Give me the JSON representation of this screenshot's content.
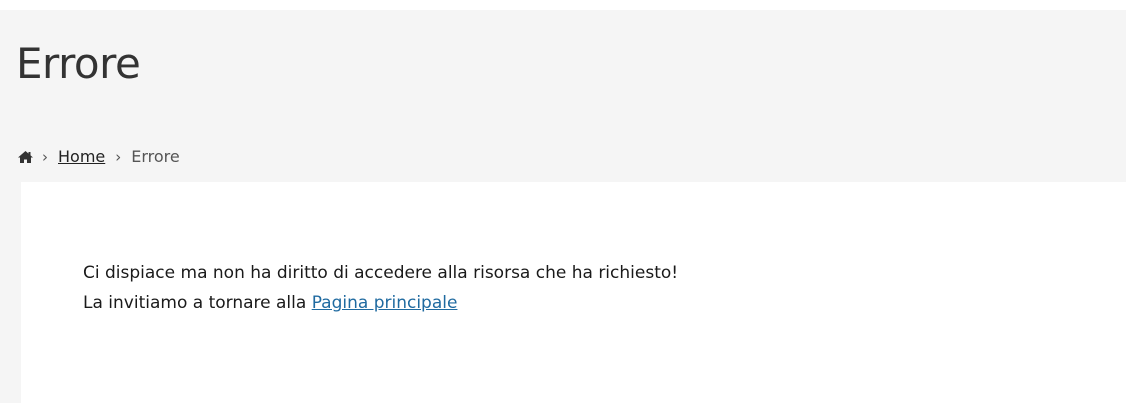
{
  "page": {
    "title": "Errore"
  },
  "breadcrumb": {
    "home_icon": "home-icon",
    "separator": "›",
    "items": [
      {
        "label": "Home",
        "type": "link"
      },
      {
        "label": "Errore",
        "type": "current"
      }
    ]
  },
  "content": {
    "line1": "Ci dispiace ma non ha diritto di accedere alla risorsa che ha richiesto!",
    "line2_prefix": "La invitiamo a tornare alla",
    "link_label": "Pagina principale"
  },
  "colors": {
    "header_background": "#f5f5f5",
    "link": "#1f6aa0",
    "text": "#222222"
  }
}
